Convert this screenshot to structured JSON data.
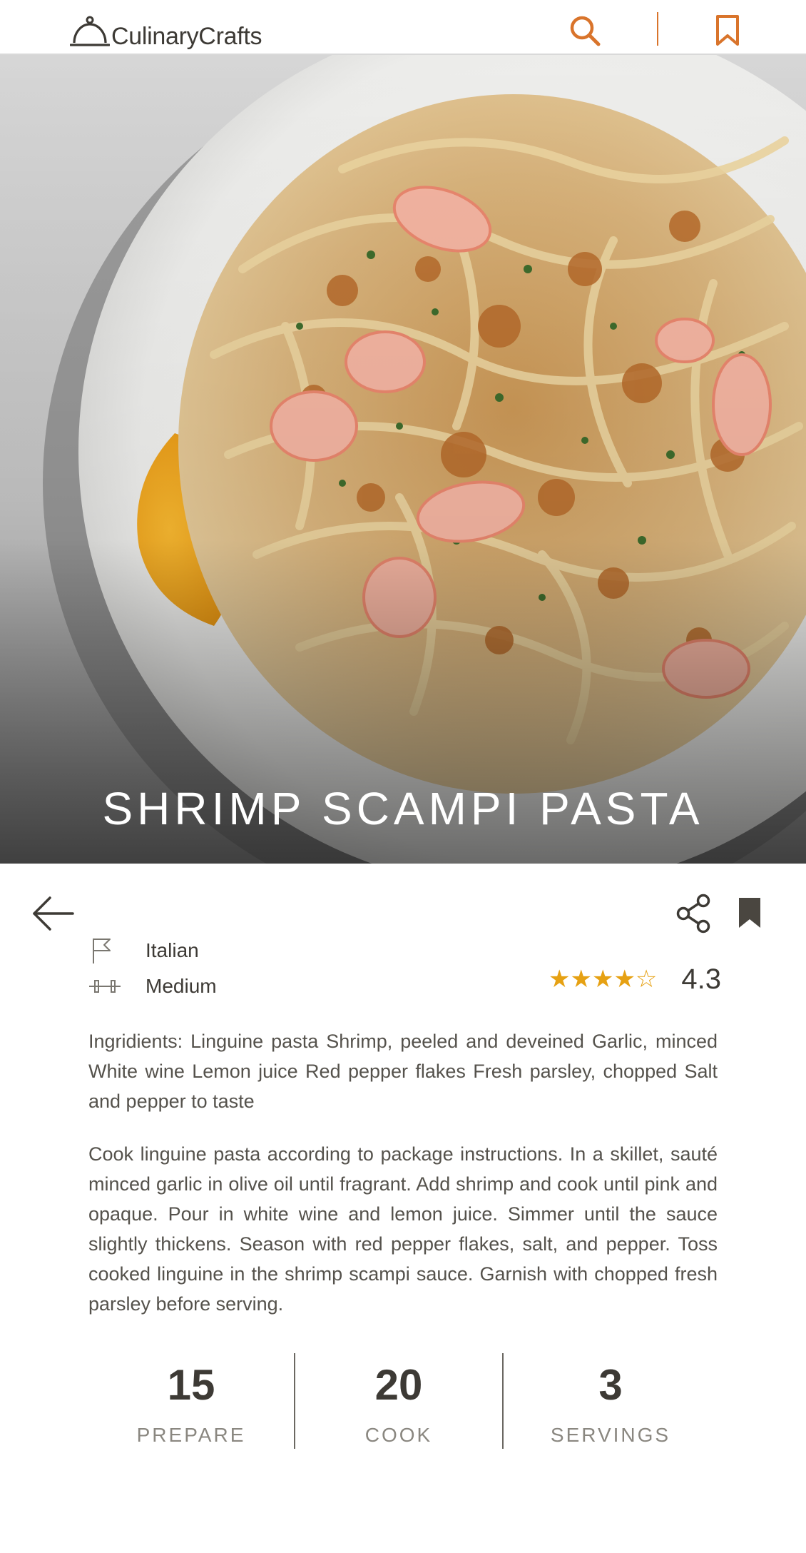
{
  "header": {
    "brand": "CulinaryCrafts",
    "icons": {
      "logo": "cloche-icon",
      "search": "search-icon",
      "bookmark": "bookmark-outline-icon"
    },
    "accent_color": "#d9742b"
  },
  "recipe": {
    "title": "SHRIMP SCAMPI PASTA",
    "cuisine": "Italian",
    "difficulty": "Medium",
    "rating": 4.3,
    "rating_text": "4.3",
    "stars_text": "★★★★☆",
    "ingredients": "Ingridients: Linguine pasta Shrimp, peeled and deveined Garlic, minced White wine Lemon juice Red pepper flakes Fresh parsley, chopped Salt and pepper to taste",
    "instructions": "Cook linguine pasta according to package instructions. In a skillet, sauté minced garlic in olive oil until fragrant. Add shrimp and cook until pink and opaque. Pour in white wine and lemon juice. Simmer until the sauce slightly thickens. Season with red pepper flakes, salt, and pepper. Toss cooked linguine in the shrimp scampi sauce. Garnish with chopped fresh parsley before serving."
  },
  "actions": {
    "icons": {
      "back": "arrow-left-icon",
      "share": "share-icon",
      "save": "bookmark-filled-icon",
      "cuisine": "flag-icon",
      "difficulty": "dumbbell-icon"
    }
  },
  "stats": [
    {
      "value": "15",
      "label": "PREPARE"
    },
    {
      "value": "20",
      "label": "COOK"
    },
    {
      "value": "3",
      "label": "SERVINGS"
    }
  ],
  "colors": {
    "star": "#e6a113",
    "text": "#3d3a35"
  }
}
